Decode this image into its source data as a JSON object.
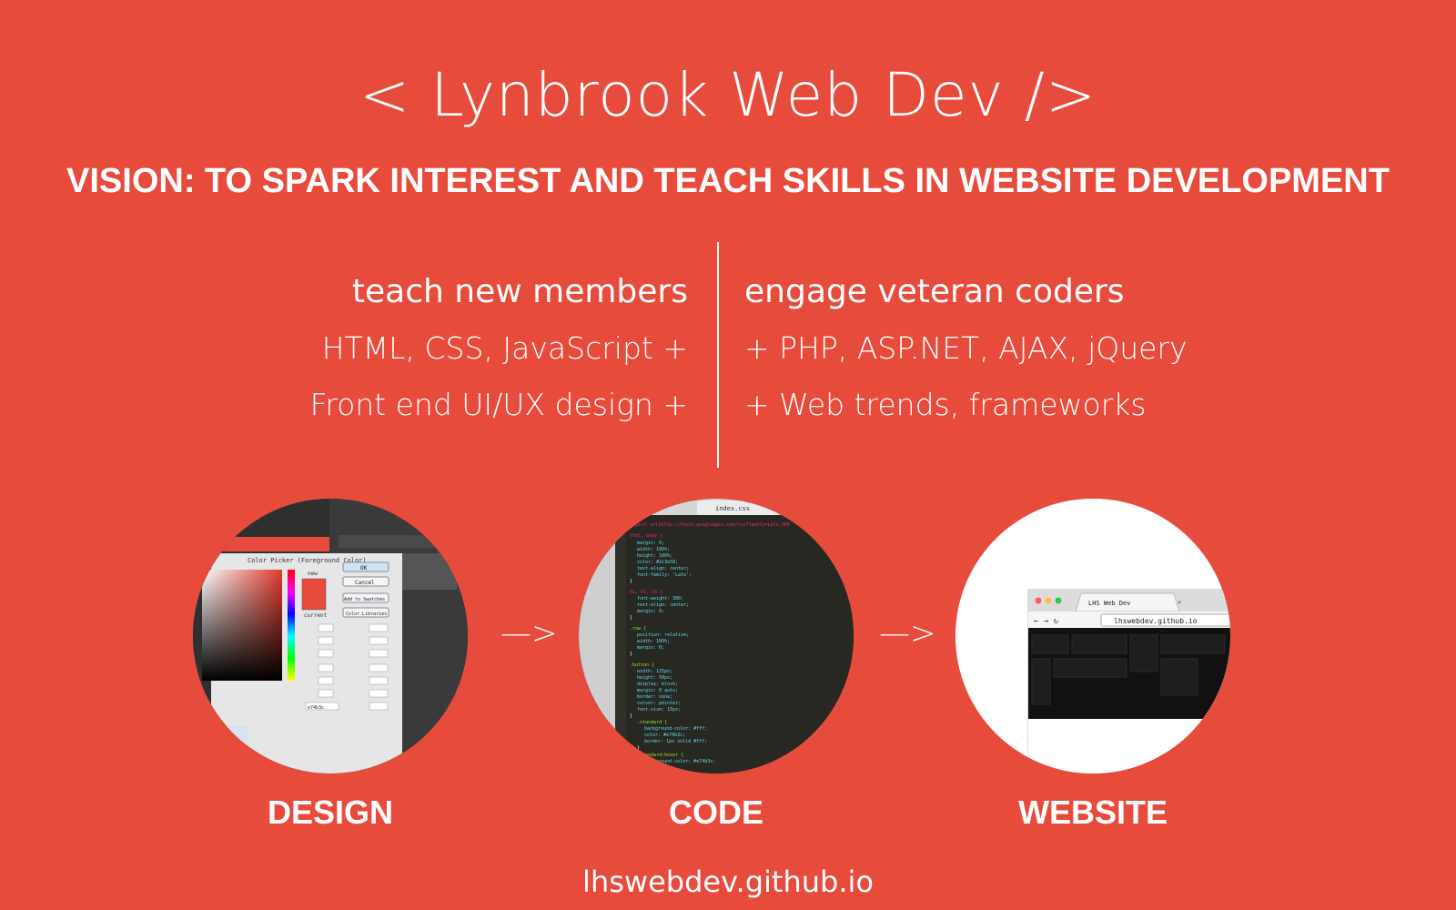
{
  "header": {
    "title": "< Lynbrook Web Dev />",
    "vision": "VISION: TO SPARK INTEREST AND TEACH SKILLS IN WEBSITE DEVELOPMENT"
  },
  "left_column": {
    "heading": "teach new members",
    "lines": [
      "HTML, CSS, JavaScript +",
      "Front end UI/UX design +"
    ]
  },
  "right_column": {
    "heading": "engage veteran coders",
    "lines": [
      "+ PHP, ASP.NET, AJAX, jQuery",
      "+ Web trends, frameworks"
    ]
  },
  "steps": [
    {
      "label": "DESIGN",
      "icon": "photoshop-color-picker-image"
    },
    {
      "label": "CODE",
      "icon": "css-code-editor-image"
    },
    {
      "label": "WEBSITE",
      "icon": "browser-window-image"
    }
  ],
  "arrow": "—>",
  "design_screenshot": {
    "dialog_title": "Color Picker (Foreground Color)",
    "ok": "OK",
    "cancel": "Cancel",
    "add_to_swatches": "Add to Swatches",
    "color_libraries": "Color Libraries",
    "new": "new",
    "current": "current",
    "hex": "e74b3c"
  },
  "code_screenshot": {
    "file_tab": "index.css",
    "import_line": "@import url(http://fonts.googleapis.com/css?family=Lato:300"
  },
  "website_screenshot": {
    "tab_title": "LHS Web Dev",
    "address": "lhswebdev.github.io"
  },
  "footer": {
    "url": "lhswebdev.github.io"
  },
  "colors": {
    "background": "#e74b3c",
    "text": "#ffffff"
  }
}
